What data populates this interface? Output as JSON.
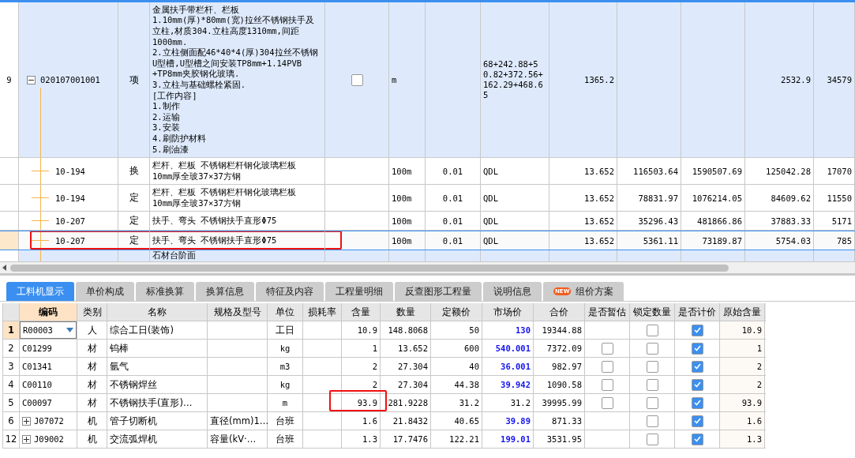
{
  "top_grid": {
    "rows": [
      {
        "kind": "item",
        "number": "9",
        "code": "020107001001",
        "expanded": true,
        "type": "项",
        "name_lines": [
          "金属扶手带栏杆、栏板",
          "1.10mm(厚)*80mm(宽)拉丝不锈钢扶手及",
          "立柱,材质304.立柱高度1310mm,间距",
          "1000mm.",
          "2.立柱侧面配46*40*4(厚)304拉丝不锈钢",
          "U型槽,U型槽之间安装TP8mm+1.14PVB",
          "+TP8mm夹胶钢化玻璃.",
          "3.立柱与基础螺栓紧固.",
          "[工作内容]",
          "1.制作",
          "2.运输",
          "3.安装",
          "4.刷防护材料",
          "5.刷油漆"
        ],
        "checked": false,
        "unit": "m",
        "column_8": "68+242.88+50.82+372.56+162.29+468.65",
        "column_9": "1365.2",
        "column_12": "2532.9",
        "column_13": "34579",
        "selected": false,
        "highlighted": false
      },
      {
        "kind": "resource",
        "code": "10-194",
        "type": "换",
        "name_lines": [
          "栏杆、栏板 不锈钢栏杆钢化玻璃栏板",
          "10mm厚全玻37×37方钢"
        ],
        "unit": "100m",
        "column_7": "0.01",
        "column_8": "QDL",
        "column_9": "13.652",
        "column_10": "116503.64",
        "column_11": "1590507.69",
        "column_12": "125042.28",
        "column_13": "17070",
        "selected": false,
        "highlighted": false
      },
      {
        "kind": "resource",
        "code": "10-194",
        "type": "定",
        "name_lines": [
          "栏杆、栏板 不锈钢栏杆钢化玻璃栏板",
          "10mm厚全玻37×37方钢"
        ],
        "unit": "100m",
        "column_7": "0.01",
        "column_8": "QDL",
        "column_9": "13.652",
        "column_10": "78831.97",
        "column_11": "1076214.05",
        "column_12": "84609.62",
        "column_13": "11550",
        "selected": false,
        "highlighted": false
      },
      {
        "kind": "resource",
        "code": "10-207",
        "type": "定",
        "name_lines": [
          "扶手、弯头 不锈钢扶手直形Φ75"
        ],
        "unit": "100m",
        "column_7": "0.01",
        "column_8": "QDL",
        "column_9": "13.652",
        "column_10": "35296.43",
        "column_11": "481866.86",
        "column_12": "37883.33",
        "column_13": "5171",
        "selected": false,
        "highlighted": false
      },
      {
        "kind": "resource",
        "code": "10-207",
        "type": "定",
        "name_lines": [
          "扶手、弯头 不锈钢扶手直形Φ75"
        ],
        "unit": "100m",
        "column_7": "0.01",
        "column_8": "QDL",
        "column_9": "13.652",
        "column_10": "5361.11",
        "column_11": "73189.87",
        "column_12": "5754.03",
        "column_13": "785",
        "selected": true,
        "highlighted": true
      },
      {
        "kind": "partial",
        "name_lines": [
          "石材台阶面"
        ],
        "selected": false,
        "highlighted": false
      }
    ]
  },
  "tabs": [
    {
      "label": "工料机显示",
      "selected": true
    },
    {
      "label": "单价构成",
      "selected": false
    },
    {
      "label": "标准换算",
      "selected": false
    },
    {
      "label": "换算信息",
      "selected": false
    },
    {
      "label": "特征及内容",
      "selected": false
    },
    {
      "label": "工程量明细",
      "selected": false
    },
    {
      "label": "反查图形工程量",
      "selected": false
    },
    {
      "label": "说明信息",
      "selected": false
    },
    {
      "label": "组价方案",
      "badge": "NEW",
      "selected": false
    }
  ],
  "materials": {
    "columns": [
      "编码",
      "类别",
      "名称",
      "规格及型号",
      "单位",
      "损耗率",
      "含量",
      "数量",
      "定额价",
      "市场价",
      "合价",
      "是否暂估",
      "锁定数量",
      "是否计价",
      "原始含量"
    ],
    "rows": [
      {
        "number": "1",
        "code": "R00003",
        "has_dropdown": true,
        "category": "人",
        "name": "综合工日(装饰)",
        "unit": "工日",
        "content": "10.9",
        "quantity": "148.8068",
        "quota_price": "50",
        "market_price": "130",
        "price_changed": true,
        "total": "19344.88",
        "locked": false,
        "priced": true,
        "original_content": "10.9",
        "selected": true,
        "highlighted": false
      },
      {
        "number": "2",
        "code": "C01299",
        "category": "材",
        "name": "钨棒",
        "unit": "kg",
        "content": "1",
        "quantity": "13.652",
        "quota_price": "600",
        "market_price": "540.001",
        "price_changed": true,
        "total": "7372.09",
        "estimated": false,
        "locked": false,
        "priced": true,
        "original_content": "1",
        "selected": false,
        "highlighted": false
      },
      {
        "number": "3",
        "code": "C01341",
        "category": "材",
        "name": "氩气",
        "unit": "m3",
        "content": "2",
        "quantity": "27.304",
        "quota_price": "40",
        "market_price": "36.001",
        "price_changed": true,
        "total": "982.97",
        "estimated": false,
        "locked": false,
        "priced": true,
        "original_content": "2",
        "selected": false,
        "highlighted": false
      },
      {
        "number": "4",
        "code": "C00110",
        "category": "材",
        "name": "不锈钢焊丝",
        "unit": "kg",
        "content": "2",
        "quantity": "27.304",
        "quota_price": "44.38",
        "market_price": "39.942",
        "price_changed": true,
        "total": "1090.58",
        "estimated": false,
        "locked": false,
        "priced": true,
        "original_content": "2",
        "selected": false,
        "highlighted": false
      },
      {
        "number": "5",
        "code": "C00097",
        "category": "材",
        "name": "不锈钢扶手(直形)…",
        "unit": "m",
        "content": "93.9",
        "quantity": "281.9228",
        "quota_price": "31.2",
        "market_price": "31.2",
        "price_changed": false,
        "total": "39995.99",
        "estimated": false,
        "locked": false,
        "priced": true,
        "original_content": "93.9",
        "selected": false,
        "highlighted": true
      },
      {
        "number": "6",
        "code": "J07072",
        "expanded": false,
        "category": "机",
        "name": "管子切断机",
        "spec": "直径(mm)1…",
        "unit": "台班",
        "content": "1.6",
        "quantity": "21.8432",
        "quota_price": "40.65",
        "market_price": "39.89",
        "price_changed": true,
        "total": "871.33",
        "locked": false,
        "priced": true,
        "original_content": "1.6",
        "selected": false,
        "highlighted": false
      },
      {
        "number": "12",
        "code": "J09002",
        "expanded": false,
        "category": "机",
        "name": "交流弧焊机",
        "spec": "容量(kV·…",
        "unit": "台班",
        "content": "1.3",
        "quantity": "17.7476",
        "quota_price": "122.21",
        "market_price": "199.01",
        "price_changed": true,
        "total": "3531.95",
        "locked": false,
        "priced": true,
        "original_content": "1.3",
        "selected": false,
        "highlighted": false
      }
    ]
  }
}
